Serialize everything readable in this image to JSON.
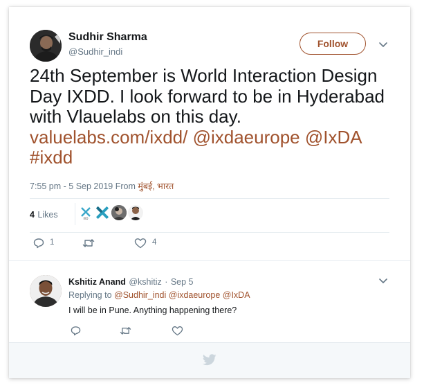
{
  "tweet": {
    "author_name": "Sudhir Sharma",
    "author_handle": "@Sudhir_indi",
    "follow_label": "Follow",
    "text_line1": "24th September is World Interaction Design",
    "text_line2": "Day IXDD. I look forward to be in Hyderabad",
    "text_line3": "with Vlauelabs on this day.",
    "link_url": "valuelabs.com/ixdd/",
    "mention_1": "@ixdaeurope",
    "mention_2": "@IxDA",
    "hashtag": "#ixdd",
    "time_date": "7:55 pm - 5 Sep 2019 From",
    "location": "मुंबई, भारत",
    "likes_count": "4",
    "likes_label": "Likes",
    "reply_count": "1",
    "retweet_count": "",
    "like_count": "4"
  },
  "reply": {
    "author_name": "Kshitiz Anand",
    "author_handle": "@kshitiz",
    "separator": "·",
    "date": "Sep 5",
    "replying_prefix": "Replying to",
    "replying_to": "@Sudhir_indi @ixdaeurope @IxDA",
    "text": "I will be in Pune. Anything happening there?"
  },
  "colors": {
    "accent": "#a0522d",
    "muted": "#657786",
    "text": "#14171a",
    "twitter_gray": "#ccd6dd"
  },
  "icons": [
    "chevron-down-icon",
    "reply-icon",
    "retweet-icon",
    "heart-icon",
    "twitter-bird-icon"
  ]
}
